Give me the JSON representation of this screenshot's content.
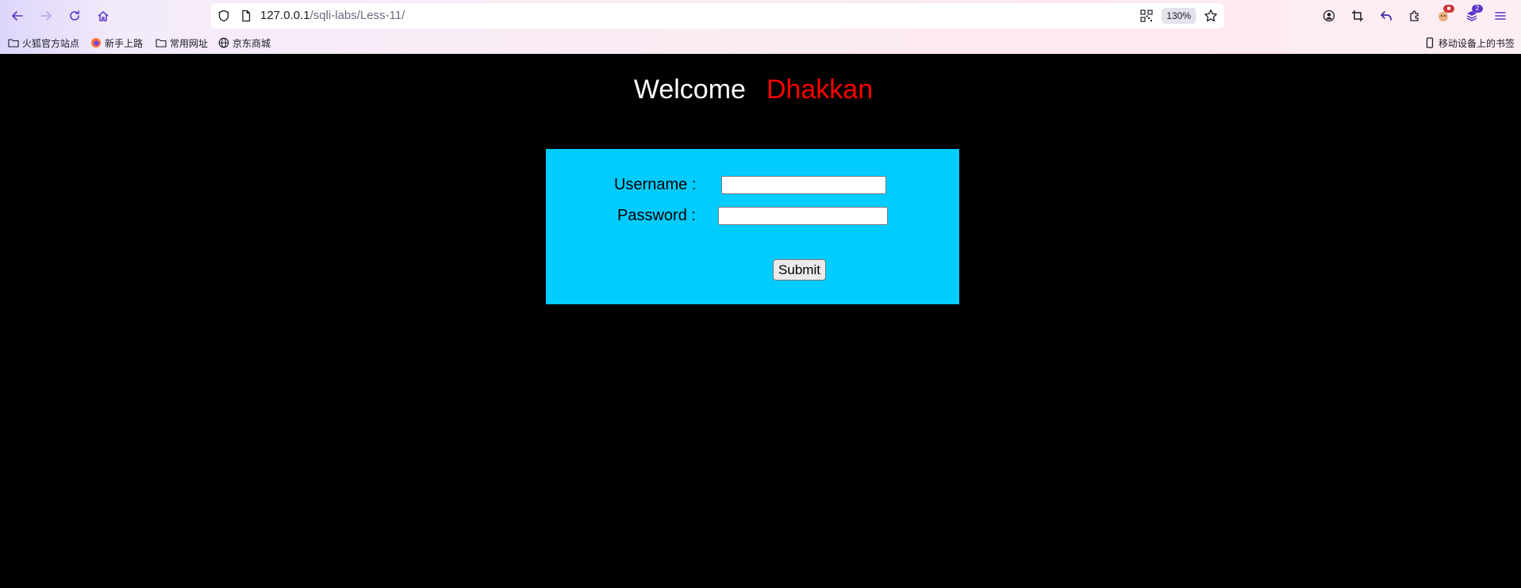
{
  "browser": {
    "url_host": "127.0.0.1",
    "url_path": "/sqli-labs/Less-11/",
    "zoom": "130%",
    "extension_badge": "2",
    "bookmarks": [
      {
        "label": "火狐官方站点"
      },
      {
        "label": "新手上路"
      },
      {
        "label": "常用网址"
      },
      {
        "label": "京东商城"
      }
    ],
    "mobile_bookmarks": "移动设备上的书签"
  },
  "page": {
    "welcome": "Welcome",
    "name": "Dhakkan",
    "username_label": "Username :",
    "password_label": "Password :",
    "username_value": "",
    "password_value": "",
    "submit_label": "Submit"
  },
  "colors": {
    "background": "#000000",
    "form_background": "#00ccff",
    "name_color": "#ff0000"
  }
}
